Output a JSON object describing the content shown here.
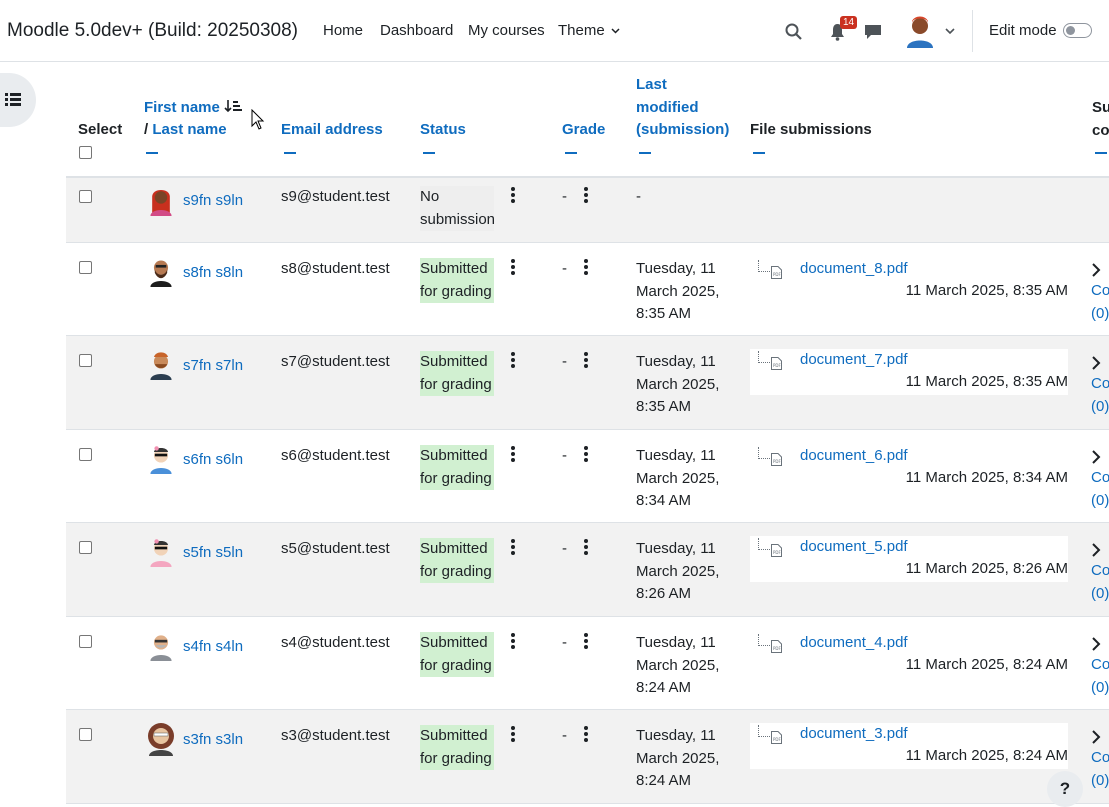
{
  "navbar": {
    "brand": "Moodle 5.0dev+ (Build: 20250308)",
    "links": [
      "Home",
      "Dashboard",
      "My courses",
      "Theme"
    ],
    "notification_count": "14",
    "edit_mode_label": "Edit mode"
  },
  "table": {
    "headers": {
      "select": "Select",
      "first_name": "First name",
      "slash": "/",
      "last_name": "Last name",
      "email": "Email address",
      "status": "Status",
      "grade": "Grade",
      "last_modified_1": "Last",
      "last_modified_2": "modified",
      "last_modified_3": "(submission)",
      "file_submissions": "File submissions",
      "comments_1": "Su",
      "comments_2": "co"
    },
    "rows": [
      {
        "name": "s9fn s9ln",
        "email": "s9@student.test",
        "status": "No submission",
        "status_type": "none",
        "grade": "-",
        "modified": "-",
        "file": "",
        "file_date": "",
        "comments_1": "",
        "comments_2": ""
      },
      {
        "name": "s8fn s8ln",
        "email": "s8@student.test",
        "status": "Submitted for grading",
        "status_type": "submitted",
        "grade": "-",
        "modified": "Tuesday, 11 March 2025, 8:35 AM",
        "file": "document_8.pdf",
        "file_date": "11 March 2025, 8:35 AM",
        "comments_1": "Co",
        "comments_2": "(0)"
      },
      {
        "name": "s7fn s7ln",
        "email": "s7@student.test",
        "status": "Submitted for grading",
        "status_type": "submitted",
        "grade": "-",
        "modified": "Tuesday, 11 March 2025, 8:35 AM",
        "file": "document_7.pdf",
        "file_date": "11 March 2025, 8:35 AM",
        "comments_1": "Co",
        "comments_2": "(0)"
      },
      {
        "name": "s6fn s6ln",
        "email": "s6@student.test",
        "status": "Submitted for grading",
        "status_type": "submitted",
        "grade": "-",
        "modified": "Tuesday, 11 March 2025, 8:34 AM",
        "file": "document_6.pdf",
        "file_date": "11 March 2025, 8:34 AM",
        "comments_1": "Co",
        "comments_2": "(0)"
      },
      {
        "name": "s5fn s5ln",
        "email": "s5@student.test",
        "status": "Submitted for grading",
        "status_type": "submitted",
        "grade": "-",
        "modified": "Tuesday, 11 March 2025, 8:26 AM",
        "file": "document_5.pdf",
        "file_date": "11 March 2025, 8:26 AM",
        "comments_1": "Co",
        "comments_2": "(0)"
      },
      {
        "name": "s4fn s4ln",
        "email": "s4@student.test",
        "status": "Submitted for grading",
        "status_type": "submitted",
        "grade": "-",
        "modified": "Tuesday, 11 March 2025, 8:24 AM",
        "file": "document_4.pdf",
        "file_date": "11 March 2025, 8:24 AM",
        "comments_1": "Co",
        "comments_2": "(0)"
      },
      {
        "name": "s3fn s3ln",
        "email": "s3@student.test",
        "status": "Submitted for grading",
        "status_type": "submitted",
        "grade": "-",
        "modified": "Tuesday, 11 March 2025, 8:24 AM",
        "file": "document_3.pdf",
        "file_date": "11 March 2025, 8:24 AM",
        "comments_1": "Co",
        "comments_2": "(0)"
      }
    ]
  },
  "help_label": "?",
  "colors": {
    "link": "#0f6cbf",
    "submitted_bg": "#d1f0d1",
    "badge": "#ca3120",
    "alt_row": "#f2f2f2"
  }
}
